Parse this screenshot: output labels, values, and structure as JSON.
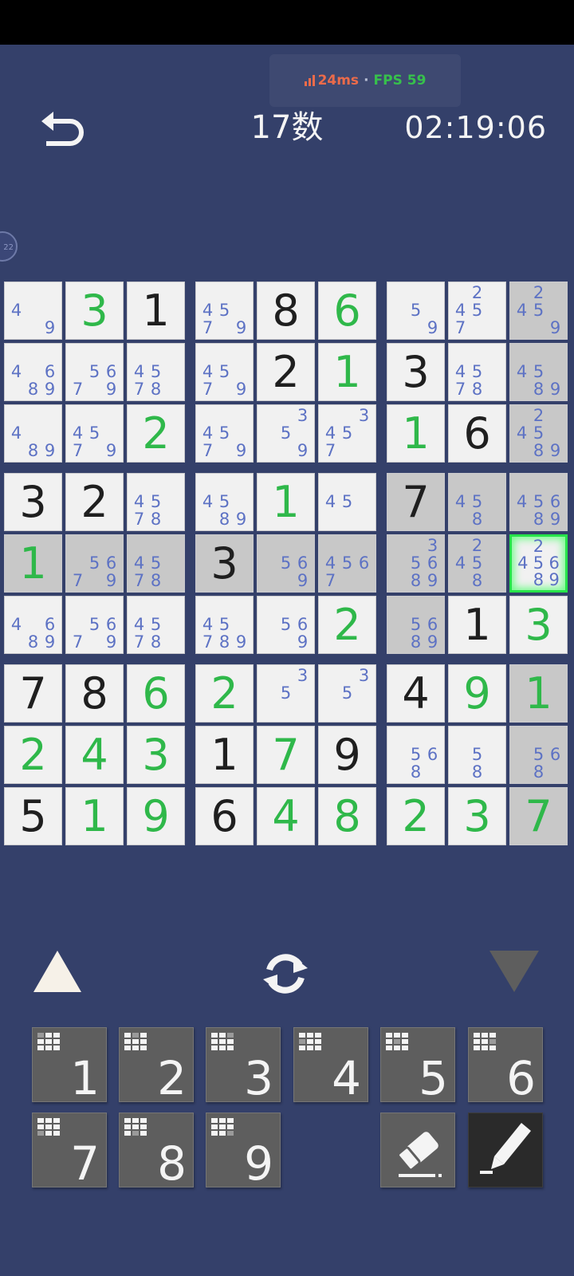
{
  "perf": {
    "ping": "24ms",
    "separator": "·",
    "fps": "FPS 59"
  },
  "header": {
    "title": "17数",
    "timer": "02:19:06"
  },
  "side_badge": "22",
  "colors": {
    "background": "#34406a",
    "given_digit": "#1f1f1f",
    "user_digit": "#2fb84a",
    "note_digit": "#5d72c4",
    "selected_outline": "#27e34a",
    "shaded_cell": "#c8c8c8"
  },
  "selected_cell": {
    "row": 5,
    "col": 9
  },
  "board": [
    [
      {
        "n": [
          4,
          9
        ]
      },
      {
        "v": "3",
        "t": "u"
      },
      {
        "v": "1",
        "t": "g"
      },
      {
        "n": [
          4,
          5,
          7,
          9
        ]
      },
      {
        "v": "8",
        "t": "g"
      },
      {
        "v": "6",
        "t": "u"
      },
      {
        "n": [
          5,
          9
        ]
      },
      {
        "n": [
          2,
          4,
          5,
          7
        ]
      },
      {
        "n": [
          2,
          4,
          5,
          9
        ],
        "s": 1
      }
    ],
    [
      {
        "n": [
          4,
          6,
          8,
          9
        ]
      },
      {
        "n": [
          5,
          6,
          7,
          9
        ]
      },
      {
        "n": [
          4,
          5,
          7,
          8
        ]
      },
      {
        "n": [
          4,
          5,
          7,
          9
        ]
      },
      {
        "v": "2",
        "t": "g"
      },
      {
        "v": "1",
        "t": "u"
      },
      {
        "v": "3",
        "t": "g"
      },
      {
        "n": [
          4,
          5,
          7,
          8
        ]
      },
      {
        "n": [
          4,
          5,
          8,
          9
        ],
        "s": 1
      }
    ],
    [
      {
        "n": [
          4,
          8,
          9
        ]
      },
      {
        "n": [
          4,
          5,
          7,
          9
        ]
      },
      {
        "v": "2",
        "t": "u"
      },
      {
        "n": [
          4,
          5,
          7,
          9
        ]
      },
      {
        "n": [
          3,
          5,
          9
        ]
      },
      {
        "n": [
          3,
          4,
          5,
          7
        ]
      },
      {
        "v": "1",
        "t": "u"
      },
      {
        "v": "6",
        "t": "g"
      },
      {
        "n": [
          2,
          4,
          5,
          8,
          9
        ],
        "s": 1
      }
    ],
    [
      {
        "v": "3",
        "t": "g"
      },
      {
        "v": "2",
        "t": "g"
      },
      {
        "n": [
          4,
          5,
          7,
          8
        ]
      },
      {
        "n": [
          4,
          5,
          8,
          9
        ]
      },
      {
        "v": "1",
        "t": "u"
      },
      {
        "n": [
          4,
          5
        ]
      },
      {
        "v": "7",
        "t": "g",
        "s": 1
      },
      {
        "n": [
          4,
          5,
          8
        ],
        "s": 1
      },
      {
        "n": [
          4,
          5,
          6,
          8,
          9
        ],
        "s": 1
      }
    ],
    [
      {
        "v": "1",
        "t": "u",
        "s": 1
      },
      {
        "n": [
          5,
          6,
          7,
          9
        ],
        "s": 1
      },
      {
        "n": [
          4,
          5,
          7,
          8
        ],
        "s": 1
      },
      {
        "v": "3",
        "t": "g",
        "s": 1
      },
      {
        "n": [
          5,
          6,
          9
        ],
        "s": 1
      },
      {
        "n": [
          4,
          5,
          6,
          7
        ],
        "s": 1
      },
      {
        "n": [
          3,
          5,
          6,
          8,
          9
        ],
        "s": 1
      },
      {
        "n": [
          2,
          4,
          5,
          8
        ],
        "s": 1
      },
      {
        "n": [
          2,
          4,
          5,
          6,
          8,
          9
        ],
        "sel": 1
      }
    ],
    [
      {
        "n": [
          4,
          6,
          8,
          9
        ]
      },
      {
        "n": [
          5,
          6,
          7,
          9
        ]
      },
      {
        "n": [
          4,
          5,
          7,
          8
        ]
      },
      {
        "n": [
          4,
          5,
          7,
          8,
          9
        ]
      },
      {
        "n": [
          5,
          6,
          9
        ]
      },
      {
        "v": "2",
        "t": "u"
      },
      {
        "n": [
          5,
          6,
          8,
          9
        ],
        "s": 1
      },
      {
        "v": "1",
        "t": "g"
      },
      {
        "v": "3",
        "t": "u"
      }
    ],
    [
      {
        "v": "7",
        "t": "g"
      },
      {
        "v": "8",
        "t": "g"
      },
      {
        "v": "6",
        "t": "u"
      },
      {
        "v": "2",
        "t": "u"
      },
      {
        "n": [
          3,
          5
        ]
      },
      {
        "n": [
          3,
          5
        ]
      },
      {
        "v": "4",
        "t": "g"
      },
      {
        "v": "9",
        "t": "u"
      },
      {
        "v": "1",
        "t": "u",
        "s": 1
      }
    ],
    [
      {
        "v": "2",
        "t": "u"
      },
      {
        "v": "4",
        "t": "u"
      },
      {
        "v": "3",
        "t": "u"
      },
      {
        "v": "1",
        "t": "g"
      },
      {
        "v": "7",
        "t": "u"
      },
      {
        "v": "9",
        "t": "g"
      },
      {
        "n": [
          5,
          6,
          8
        ]
      },
      {
        "n": [
          5,
          8
        ]
      },
      {
        "n": [
          5,
          6,
          8
        ],
        "s": 1
      }
    ],
    [
      {
        "v": "5",
        "t": "g"
      },
      {
        "v": "1",
        "t": "u"
      },
      {
        "v": "9",
        "t": "u"
      },
      {
        "v": "6",
        "t": "g"
      },
      {
        "v": "4",
        "t": "u"
      },
      {
        "v": "8",
        "t": "u"
      },
      {
        "v": "2",
        "t": "u"
      },
      {
        "v": "3",
        "t": "u"
      },
      {
        "v": "7",
        "t": "u",
        "s": 1
      }
    ]
  ],
  "controls": {
    "prev_icon": "triangle-up-icon",
    "swap_icon": "refresh-icon",
    "next_icon": "triangle-down-icon"
  },
  "keypad": [
    "1",
    "2",
    "3",
    "4",
    "5",
    "6",
    "7",
    "8",
    "9"
  ],
  "tools": {
    "erase_icon": "eraser-icon",
    "pencil_icon": "pencil-icon",
    "pencil_active": true
  }
}
